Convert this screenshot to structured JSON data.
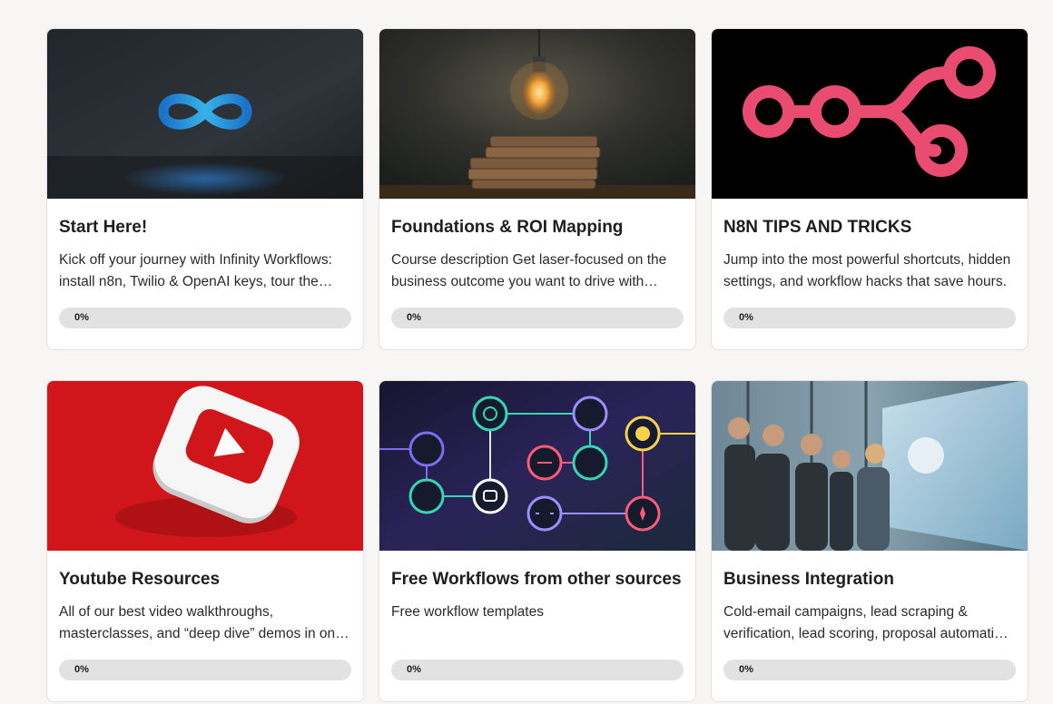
{
  "courses": [
    {
      "title": "Start Here!",
      "description": "Kick off your journey with Infinity Workflows: install n8n, Twilio & OpenAI keys, tour the dashboard, and build your first automation.",
      "progress_label": "0%",
      "progress": 0,
      "image": "infinity-logo-image"
    },
    {
      "title": "Foundations & ROI Mapping",
      "description": "Course description Get laser-focused on the business outcome you want to drive with automation.",
      "progress_label": "0%",
      "progress": 0,
      "image": "lightbulb-books-image"
    },
    {
      "title": "N8N TIPS AND TRICKS",
      "description": "Jump into the most powerful shortcuts, hidden settings, and workflow hacks that save hours.",
      "progress_label": "0%",
      "progress": 0,
      "image": "n8n-logo-image"
    },
    {
      "title": "Youtube Resources",
      "description": "All of our best video walkthroughs, masterclasses, and “deep dive” demos in one place.",
      "progress_label": "0%",
      "progress": 0,
      "image": "youtube-logo-image"
    },
    {
      "title": "Free Workflows from other sources",
      "description": "Free workflow templates",
      "progress_label": "0%",
      "progress": 0,
      "image": "workflow-nodes-image"
    },
    {
      "title": "Business Integration",
      "description": "Cold-email campaigns, lead scraping & verification, lead scoring, proposal automation and more.",
      "progress_label": "0%",
      "progress": 0,
      "image": "business-team-image"
    }
  ],
  "colors": {
    "progress_track": "#e2e2e2",
    "progress_fill": "#3b82f6",
    "n8n_pink": "#ea4b71",
    "youtube_red": "#d0161b"
  }
}
